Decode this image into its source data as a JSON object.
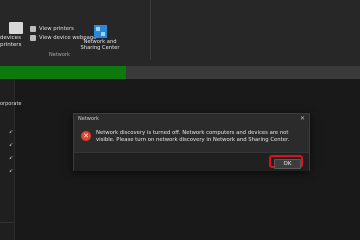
{
  "ribbon": {
    "left_fragment": [
      "devices",
      "printers"
    ],
    "view_printers": "View printers",
    "view_device_webpage": "View device webpage",
    "group_label": "Network",
    "nsc_label": [
      "Network and",
      "Sharing Center"
    ]
  },
  "nav": {
    "fragment": "orporate"
  },
  "progress": {
    "green_fraction": 0.35,
    "green_color": "#0e7a0d"
  },
  "dialog": {
    "title": "Network",
    "close_glyph": "✕",
    "icon": "error-icon",
    "message": "Network discovery is turned off. Network computers and devices are not visible. Please turn on network discovery in Network and Sharing Center.",
    "ok_label": "OK",
    "highlight_color": "#e0101a"
  }
}
